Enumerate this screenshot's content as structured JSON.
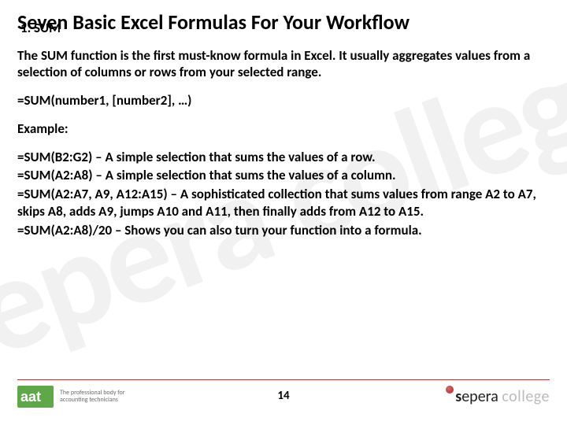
{
  "watermark": "sepera college",
  "title": "Seven Basic Excel Formulas For Your Workflow",
  "subhead": "1. SUM",
  "para_intro": "The SUM function is the first must-know formula in Excel. It usually aggregates values from a selection of columns or rows from your selected range.",
  "para_syntax": "=SUM(number1, [number2], …)",
  "example_label": "Example:",
  "ex1": "=SUM(B2:G2) – A simple selection that sums the values of a row.",
  "ex2": "=SUM(A2:A8) – A simple selection that sums the values of a column.",
  "ex3": "=SUM(A2:A7, A9, A12:A15) – A sophisticated collection that sums values from range A2 to A7, skips A8, adds A9, jumps A10 and A11, then finally adds from A12 to A15.",
  "ex4": "=SUM(A2:A8)/20 – Shows you can also turn your function into a formula.",
  "page_number": "14",
  "aat": {
    "brand": "aat",
    "tagline_l1": "The professional body for",
    "tagline_l2": "accounting technicians"
  },
  "sepera": {
    "s": "s",
    "epera": "epera",
    "college": "college"
  }
}
